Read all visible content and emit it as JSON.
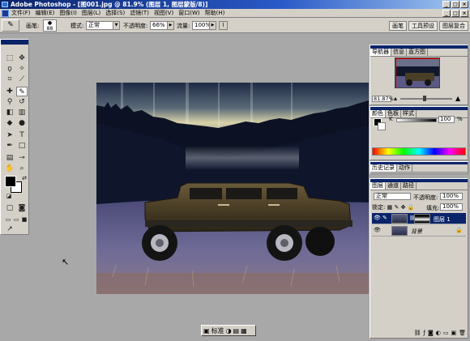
{
  "window": {
    "title": "Adobe Photoshop - [图001.jpg @ 81.9% (图层 1, 图层蒙版/8)]",
    "buttons": [
      "_",
      "□",
      "×"
    ]
  },
  "menu": {
    "items": [
      "文件(F)",
      "编辑(E)",
      "图像(I)",
      "图层(L)",
      "选择(S)",
      "滤镜(T)",
      "视图(V)",
      "窗口(W)",
      "帮助(H)"
    ],
    "doc_buttons": [
      "_",
      "□",
      "×"
    ]
  },
  "options": {
    "tool_icon": "brush-icon",
    "brush_label": "画笔:",
    "brush_size": "88",
    "mode_label": "模式:",
    "mode_value": "正常",
    "opacity_label": "不透明度:",
    "opacity_value": "66%",
    "flow_label": "流量:",
    "flow_value": "100%",
    "palette_well": [
      "画笔",
      "工具预设",
      "图层复合"
    ]
  },
  "navigator": {
    "tabs": [
      "导航器",
      "信息",
      "直方图"
    ],
    "zoom": "81.87%"
  },
  "color": {
    "tabs": [
      "颜色",
      "色板",
      "样式"
    ],
    "channel_label": "K",
    "channel_value": "100",
    "channel_unit": "%"
  },
  "history": {
    "tabs": [
      "历史记录",
      "动作"
    ]
  },
  "layers": {
    "tabs": [
      "图层",
      "通道",
      "路径"
    ],
    "blend_mode": "正常",
    "opacity_label": "不透明度:",
    "opacity_value": "100%",
    "lock_label": "锁定:",
    "fill_label": "填充:",
    "fill_value": "100%",
    "rows": [
      {
        "name": "图层 1",
        "selected": true
      },
      {
        "name": "背景",
        "selected": false
      }
    ]
  },
  "statusbar": {
    "mode_label": "标准"
  },
  "colors": {
    "title_bar": "#0a246a",
    "chrome": "#d4d0c8",
    "workspace": "#a8a8a8",
    "selected_layer": "#0a246a"
  }
}
